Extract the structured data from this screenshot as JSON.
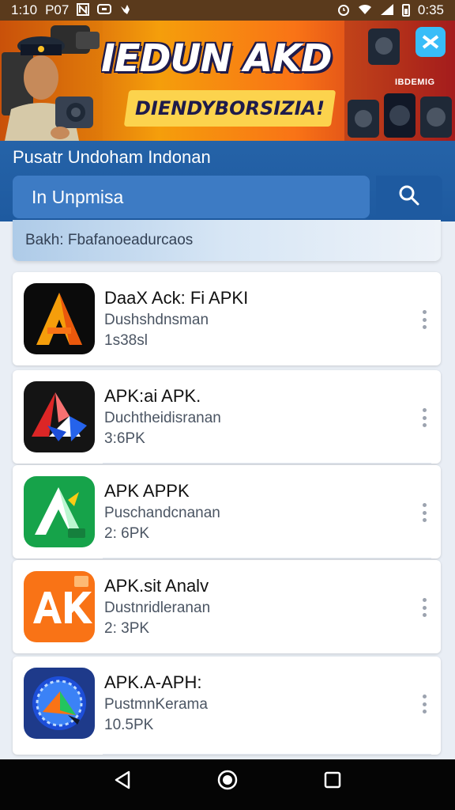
{
  "status_bar": {
    "time": "1:10",
    "text2": "P07",
    "battery_text": "0:35",
    "icons": [
      "n-icon",
      "message-icon",
      "bird-icon",
      "alarm-icon",
      "wifi-icon",
      "signal-icon",
      "battery-icon"
    ]
  },
  "banner": {
    "title": "IEDUN AKD",
    "subtitle": "DIENDYBORSIZIA!",
    "brand": "IBDEMIG",
    "colors": {
      "primary": "#f59e0b",
      "secondary": "#b91c1c",
      "accent": "#fcd34d"
    }
  },
  "header": {
    "title": "Pusatr Undoham Indonan",
    "search_value": "In Unpmisa",
    "search_icon": "search-icon",
    "color": "#1e5aa0"
  },
  "filter": {
    "label": "Bakh: Fbafanoeadurcaos"
  },
  "apps": [
    {
      "name": "DaaX Ack: Fi APKI",
      "developer": "Dushshdnsman",
      "size": "1s38sl",
      "icon": "orange-a-icon"
    },
    {
      "name": "APK:ai APK.",
      "developer": "Duchtheidisranan",
      "size": "3:6PK",
      "icon": "red-blue-a-icon"
    },
    {
      "name": "APK APPK",
      "developer": "Puschandcnanan",
      "size": "2: 6PK",
      "icon": "green-a-icon"
    },
    {
      "name": "APK.sit Analv",
      "developer": "Dustnridleranan",
      "size": "2: 3PK",
      "icon": "orange-ak-icon"
    },
    {
      "name": "APK.A-APH:",
      "developer": "PustmnKerama",
      "size": "10.5PK",
      "icon": "blue-compass-icon"
    }
  ],
  "nav": {
    "icons": [
      "back-icon",
      "home-icon",
      "recents-icon"
    ]
  }
}
